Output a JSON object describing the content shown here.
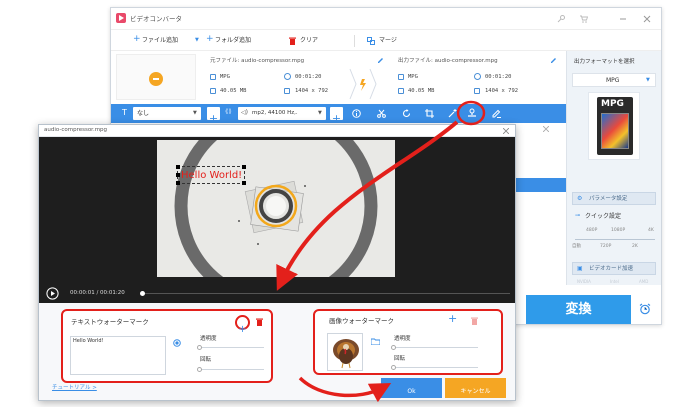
{
  "main_window": {
    "title": "ビデオコンバータ",
    "toolbar": {
      "add_file": "ファイル追加",
      "add_folder": "フォルダ追加",
      "clear": "クリア",
      "merge": "マージ"
    },
    "file": {
      "source_name": "元ファイル: audio-compressor.mpg",
      "output_name": "出力ファイル: audio-compressor.mpg",
      "src_format": "MPG",
      "src_duration": "00:01:20",
      "src_size": "40.05 MB",
      "src_resolution": "1404 x 792",
      "out_format": "MPG",
      "out_duration": "00:01:20",
      "out_size": "40.05 MB",
      "out_resolution": "1404 x 792"
    },
    "edit_bar": {
      "subtitle": "なし",
      "audio": "mp2, 44100 Hz,."
    },
    "right_panel": {
      "select_format_label": "出力フォーマットを選択",
      "format": "MPG",
      "format_badge": "MPG",
      "params_button": "パラメータ設定",
      "quick_settings": "クイック設定",
      "quality_top": [
        "480P",
        "1080P",
        "4K"
      ],
      "quality_bottom": [
        "自動",
        "720P",
        "2K"
      ],
      "gpu_button": "ビデオカード加速",
      "gpu_brands": [
        "NVIDIA",
        "Intel",
        "AMD"
      ]
    },
    "convert_button": "変換"
  },
  "dialog": {
    "title": "audio-compressor.mpg",
    "player": {
      "time": "00:00:01 / 00:01:20",
      "progress": 0.01
    },
    "preview_text": "Hello World!",
    "text_watermark": {
      "title": "テキストウォーターマーク",
      "text": "Hello World!",
      "opacity_label": "透明度",
      "rotation_label": "回転"
    },
    "image_watermark": {
      "title": "画像ウォーターマーク",
      "opacity_label": "透明度",
      "rotation_label": "回転"
    },
    "tutorial_link": "チュートリアル >",
    "ok_button": "Ok",
    "cancel_button": "キャンセル"
  },
  "colors": {
    "accent": "#3a8ee6",
    "annotation": "#e3201b",
    "cancel": "#f5a623",
    "convert": "#2f9bea",
    "dark_bg": "#1e1e1e"
  }
}
